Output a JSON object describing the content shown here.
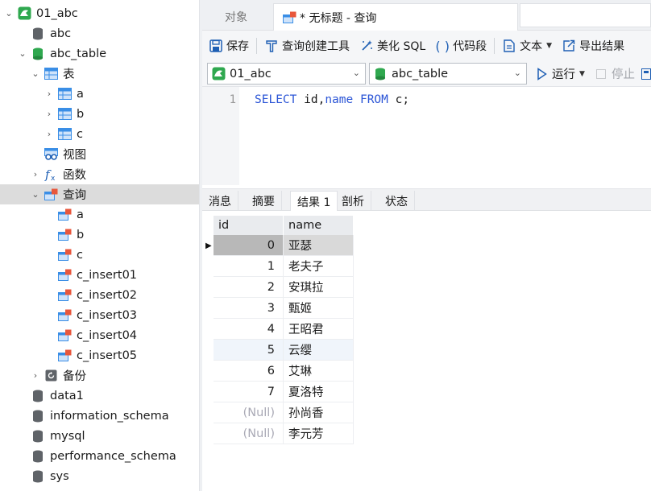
{
  "colors": {
    "mysql_green": "#2fa84f",
    "table_blue": "#3a8ee6",
    "query_red": "#e8573c",
    "keyword_blue": "#2b55d6"
  },
  "sidebar": {
    "rows": [
      {
        "label": "01_abc",
        "icon": "mysql-connection-icon",
        "expand": "down"
      },
      {
        "label": "abc",
        "icon": "database-grey-icon",
        "expand": ""
      },
      {
        "label": "abc_table",
        "icon": "database-green-icon",
        "expand": "down"
      },
      {
        "label": "表",
        "icon": "tables-folder-icon",
        "expand": "down"
      },
      {
        "label": "a",
        "icon": "table-icon",
        "expand": "right"
      },
      {
        "label": "b",
        "icon": "table-icon",
        "expand": "right"
      },
      {
        "label": "c",
        "icon": "table-icon",
        "expand": "right"
      },
      {
        "label": "视图",
        "icon": "views-icon",
        "expand": ""
      },
      {
        "label": "函数",
        "icon": "function-icon",
        "expand": "right"
      },
      {
        "label": "查询",
        "icon": "queries-folder-icon",
        "expand": "down"
      },
      {
        "label": "a",
        "icon": "query-icon",
        "expand": ""
      },
      {
        "label": "b",
        "icon": "query-icon",
        "expand": ""
      },
      {
        "label": "c",
        "icon": "query-icon",
        "expand": ""
      },
      {
        "label": "c_insert01",
        "icon": "query-icon",
        "expand": ""
      },
      {
        "label": "c_insert02",
        "icon": "query-icon",
        "expand": ""
      },
      {
        "label": "c_insert03",
        "icon": "query-icon",
        "expand": ""
      },
      {
        "label": "c_insert04",
        "icon": "query-icon",
        "expand": ""
      },
      {
        "label": "c_insert05",
        "icon": "query-icon",
        "expand": ""
      },
      {
        "label": "备份",
        "icon": "backup-icon",
        "expand": "right"
      },
      {
        "label": "data1",
        "icon": "database-grey-icon",
        "expand": ""
      },
      {
        "label": "information_schema",
        "icon": "database-grey-icon",
        "expand": ""
      },
      {
        "label": "mysql",
        "icon": "database-grey-icon",
        "expand": ""
      },
      {
        "label": "performance_schema",
        "icon": "database-grey-icon",
        "expand": ""
      },
      {
        "label": "sys",
        "icon": "database-grey-icon",
        "expand": ""
      }
    ]
  },
  "tabs": {
    "objects": "对象",
    "query": "* 无标题 - 查询"
  },
  "toolbar": {
    "save": "保存",
    "query_builder": "查询创建工具",
    "beautify": "美化 SQL",
    "snippet": "代码段",
    "text": "文本",
    "export": "导出结果"
  },
  "selectors": {
    "connection": "01_abc",
    "database": "abc_table",
    "run": "运行",
    "stop": "停止"
  },
  "editor": {
    "line_number": "1",
    "tokens": [
      "SELECT",
      " id,",
      "name",
      " ",
      "FROM",
      " c;"
    ]
  },
  "result_tabs": [
    "消息",
    "摘要",
    "结果 1",
    "剖析",
    "状态"
  ],
  "grid": {
    "columns": [
      "id",
      "name"
    ],
    "rows": [
      {
        "id": "0",
        "name": "亚瑟"
      },
      {
        "id": "1",
        "name": "老夫子"
      },
      {
        "id": "2",
        "name": "安琪拉"
      },
      {
        "id": "3",
        "name": "甄姬"
      },
      {
        "id": "4",
        "name": "王昭君"
      },
      {
        "id": "5",
        "name": "云缨"
      },
      {
        "id": "6",
        "name": "艾琳"
      },
      {
        "id": "7",
        "name": "夏洛特"
      },
      {
        "id": "(Null)",
        "name": "孙尚香"
      },
      {
        "id": "(Null)",
        "name": "李元芳"
      }
    ]
  }
}
